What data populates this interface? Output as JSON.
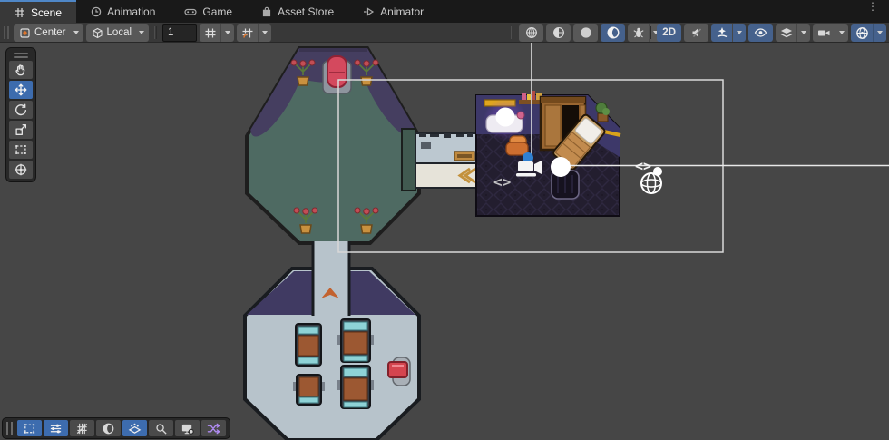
{
  "tabs": [
    {
      "label": "Scene",
      "icon": "grid-icon",
      "active": true
    },
    {
      "label": "Animation",
      "icon": "clock-icon",
      "active": false
    },
    {
      "label": "Game",
      "icon": "gamepad-icon",
      "active": false
    },
    {
      "label": "Asset Store",
      "icon": "bag-icon",
      "active": false
    },
    {
      "label": "Animator",
      "icon": "animator-icon",
      "active": false
    }
  ],
  "window_menu_icon": "kebab-menu-icon",
  "toolbar": {
    "pivot": {
      "label": "Center",
      "icon": "pivot-center-icon"
    },
    "orientation": {
      "label": "Local",
      "icon": "cube-icon"
    },
    "grid_size": {
      "value": "1"
    },
    "grid_visibility_icon": "grid-visibility-icon",
    "snap_icon": "snap-increment-icon",
    "shading_icons": [
      "wireframe-sphere-icon",
      "shaded-wireframe-sphere-icon",
      "shaded-sphere-icon",
      "scene-lighting-moon-icon"
    ],
    "debug_icon": "bug-icon",
    "mode_2d_label": "2D",
    "audio_icon": "audio-muted-icon",
    "effects_icon": "effects-icon",
    "visibility_icon": "eye-icon",
    "layers_icon": "layers-icon",
    "camera_icon": "camera-settings-icon",
    "gizmos_icon": "gizmos-globe-icon"
  },
  "left_tools": [
    {
      "name": "hand-tool",
      "active": false
    },
    {
      "name": "move-tool",
      "active": true
    },
    {
      "name": "rotate-tool",
      "active": false
    },
    {
      "name": "scale-tool",
      "active": false
    },
    {
      "name": "rect-tool",
      "active": false
    },
    {
      "name": "transform-tool",
      "active": false
    }
  ],
  "bottom_tools": [
    {
      "name": "overlay-rect-tool",
      "active": true
    },
    {
      "name": "sliders-tool",
      "active": true
    },
    {
      "name": "tile-grid-tool",
      "active": false
    },
    {
      "name": "moon-tool",
      "active": false
    },
    {
      "name": "tilemap-focus-tool",
      "active": true
    },
    {
      "name": "search-tool",
      "active": false
    },
    {
      "name": "display-capture-tool",
      "active": false
    },
    {
      "name": "shuffle-tool",
      "active": false
    }
  ],
  "scene": {
    "script_gizmo_symbol": "<>",
    "gizmos": [
      "script-gizmo",
      "camera-gizmo",
      "avatar-gizmo",
      "avatar-gizmo",
      "script-gizmo",
      "network-globe-gizmo"
    ],
    "objects": [
      "top-octagon-room",
      "red-chair",
      "potted-plants",
      "hallway-counter",
      "bedroom",
      "wardrobe",
      "bed",
      "desk",
      "orange-chair",
      "dark-chair",
      "cafeteria-room",
      "tables",
      "emergency-button"
    ]
  },
  "colors": {
    "scene_bg": "#464646",
    "panel_bg": "#383838",
    "tabbar_bg": "#191919",
    "button_bg": "#585858",
    "button_active_bg": "#45618c",
    "tab_highlight": "#4f87c7",
    "room_floor_teal": "#4e6a62",
    "room_floor_light": "#b7c3cb",
    "wall_purple": "#403a62",
    "dark_room_wall": "#3d3869",
    "dark_room_floor": "#231e2f",
    "gizmo_line": "#e8e8e8",
    "selection_outline": "#d8d8d8",
    "shuffle_purple": "#b18cf5",
    "plant_red": "#c24e55",
    "chair_red": "#d4495e",
    "button_red": "#d5454f",
    "arrow_orange": "#c2622f"
  }
}
